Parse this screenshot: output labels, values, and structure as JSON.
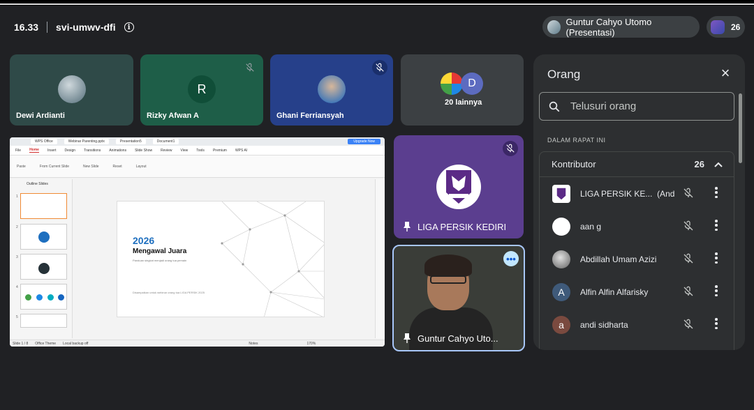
{
  "meeting": {
    "time": "16.33",
    "code": "svi-umwv-dfi",
    "presenter_chip": "Guntur Cahyo Utomo (Presentasi)",
    "participant_count": "26"
  },
  "tiles": {
    "t1_name": "Dewi Ardianti",
    "t2_name": "Rizky Afwan A",
    "t2_initial": "R",
    "t3_name": "Ghani Ferriansyah",
    "t4_name": "20 lainnya",
    "t4_initial": "D",
    "t5_name": "LIGA PERSIK KEDIRI",
    "t6_name": "Guntur Cahyo Uto..."
  },
  "shared_screen": {
    "app_tab": "WPS Office",
    "doc_tab_1": "Webinar Parenting.pptx",
    "doc_tab_2": "Presentation5",
    "doc_tab_3": "Document1",
    "upgrade": "Upgrade Now",
    "menu": [
      "File",
      "Home",
      "Insert",
      "Design",
      "Transitions",
      "Animations",
      "Slide Show",
      "Review",
      "View",
      "Tools",
      "Premium",
      "WPS AI"
    ],
    "ribbon": [
      "Paste",
      "From Current Slide",
      "New Slide",
      "Reset",
      "Layout"
    ],
    "left_tabs": "Outline   Slides",
    "slide_year": "2026",
    "slide_title": "Mengawal Juara",
    "slide_sub": "Panduan singkat menjadi orang tua pemain",
    "slide_footer": "Disampaikan untuk webinar orang tua LIGA PERSIK 2025",
    "status_left": "Slide 1 / 8",
    "status_theme": "Office Theme",
    "status_backup": "Local backup off",
    "status_notes": "Notes",
    "status_zoom": "170%"
  },
  "panel": {
    "title": "Orang",
    "search_placeholder": "Telusuri orang",
    "section": "DALAM RAPAT INI",
    "group_label": "Kontributor",
    "group_count": "26",
    "people": [
      {
        "name": "LIGA PERSIK KE...",
        "suffix": "(Anda)",
        "initial": ""
      },
      {
        "name": "aan g",
        "suffix": "",
        "initial": ""
      },
      {
        "name": "Abdillah Umam Azizi",
        "suffix": "",
        "initial": ""
      },
      {
        "name": "Alfin Alfin Alfarisky",
        "suffix": "",
        "initial": "A"
      },
      {
        "name": "andi sidharta",
        "suffix": "",
        "initial": "a"
      }
    ]
  },
  "colors": {
    "background": "#202124",
    "panel": "#2d2f31",
    "accent_border": "#a8c7fa",
    "liga_tile": "#5b3e8f"
  }
}
